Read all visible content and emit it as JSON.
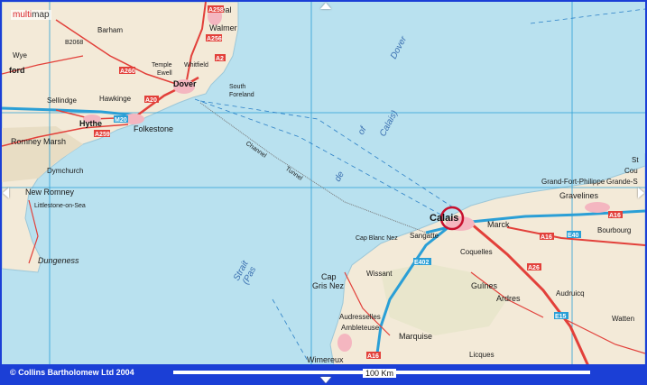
{
  "logo": {
    "prefix": "multi",
    "suffix": "map"
  },
  "footer": {
    "copyright": "© Collins Bartholomew Ltd 2004",
    "scale": "100 Km"
  },
  "colors": {
    "sea": "#b9e1ef",
    "land": "#f3ead8",
    "grid": "#2a9fd6",
    "motorway": "#2a9fd6",
    "primary": "#e2403a",
    "frame": "#1b3fd6",
    "marker": "#c8102e"
  },
  "labels": {
    "dover_strait": "Dover",
    "calais_strait": "Calais)",
    "de": "de",
    "of": "of",
    "strait": "Strait",
    "pas": "(Pas",
    "channel": "Channel",
    "tunnel": "Tunnel"
  },
  "england_towns": {
    "deal": "Deal",
    "walmer": "Walmer",
    "barham": "Barham",
    "b2068": "B2068",
    "wye": "Wye",
    "ford": "ford",
    "temple_ewell": "Temple",
    "ewell": "Ewell",
    "whitfield": "Whitfield",
    "dover": "Dover",
    "south_foreland": "South",
    "south_foreland2": "Foreland",
    "sellindge": "Sellindge",
    "hawkinge": "Hawkinge",
    "hythe": "Hythe",
    "folkestone": "Folkestone",
    "romney_marsh": "Romney Marsh",
    "dymchurch": "Dymchurch",
    "new_romney": "New Romney",
    "littlestone": "Littlestone-on-Sea",
    "dungeness": "Dungeness"
  },
  "france_towns": {
    "calais": "Calais",
    "marck": "Marck",
    "gravelines": "Gravelines",
    "grande_synthe": "Grande-S",
    "gfp": "Grand-Fort-Philippe",
    "st": "St",
    "cou": "Cou",
    "bourbourg": "Bourbourg",
    "sangatte": "Sangatte",
    "cap_blanc_nez": "Cap Blanc Nez",
    "coquelles": "Coquelles",
    "wissant": "Wissant",
    "cap_gris_nez": "Cap",
    "cap_gris_nez2": "Gris Nez",
    "guines": "Guînes",
    "ardres": "Ardres",
    "audruicq": "Audruicq",
    "watten": "Watten",
    "audresselles": "Audresselles",
    "ambleteuse": "Ambleteuse",
    "marquise": "Marquise",
    "licques": "Licques",
    "wimereux": "Wimereux"
  },
  "roads": {
    "a258": "A258",
    "a260": "A260",
    "a20": "A20",
    "a256": "A256",
    "a2": "A2",
    "a259": "A259",
    "m20": "M20",
    "a16": "A16",
    "a16b": "A16",
    "a16c": "A16",
    "e40": "E40",
    "a26": "A26",
    "e15": "E15",
    "e402": "E402"
  }
}
